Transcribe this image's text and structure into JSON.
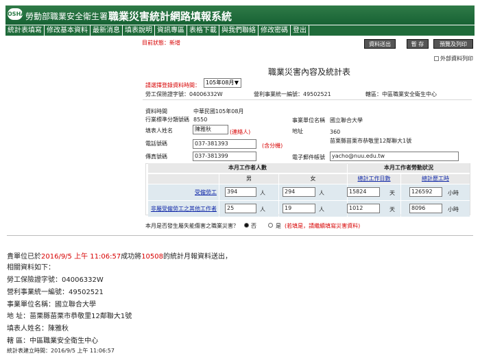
{
  "header": {
    "logo": "OSHA",
    "agency": "勞動部職業安全衛生署",
    "system": "職業災害統計網路填報系統"
  },
  "nav": [
    "統計表填寫",
    "修改基本資料",
    "最新消息",
    "填表說明",
    "資訊專區",
    "表格下載",
    "與我們聯絡",
    "修改密碼",
    "登出"
  ],
  "form": {
    "status": "目前狀態：新增",
    "buttons": {
      "send": "資料送出",
      "save": "暫 存",
      "preview": "預覽及列印"
    },
    "external": "外部資料列印",
    "title": "職業災害內容及統計表",
    "period_label": "請選擇登錄資料時間：",
    "period_value": "105年08月",
    "insurance": "勞工保險證字號：04006332W",
    "unified": "營利事業統一編號：49502521",
    "district": "轄區：中區職業安全衛生中心",
    "data_time_label": "資料時間",
    "data_time_value": "中華民國105年08月",
    "industry_label": "行業標準分類號碼",
    "industry_value": "8550",
    "unit_label": "事業單位名稱",
    "unit_value": "國立聯合大學",
    "filler_label": "填表人姓名",
    "filler_value": "陳雅秋",
    "contact_person": "(連絡人)",
    "address_label": "地址",
    "address_code": "360",
    "address_value": "苗栗縣苗栗市恭敬里12鄰聯大1號",
    "phone_label": "電話號碼",
    "phone_value": "037-381393",
    "phone_note": "(含分機)",
    "fax_label": "傳真號碼",
    "fax_value": "037-381399",
    "email_label": "電子郵件帳號",
    "email_value": "yacho@nuu.edu.tw"
  },
  "table": {
    "left_header": "本月工作者人數",
    "right_header": "本月工作者勞動狀況",
    "male": "男",
    "female": "女",
    "work_days": "總計工作日數",
    "work_hours": "總計歷工時",
    "rows": [
      {
        "label": "受僱勞工",
        "male": "394",
        "female": "294",
        "days": "15824",
        "hours": "126592"
      },
      {
        "label": "非屬受僱勞工之其他工作者",
        "male": "25",
        "female": "19",
        "days": "1012",
        "hours": "8096"
      }
    ],
    "unit_person": "人",
    "unit_day": "天",
    "unit_hour": "小時"
  },
  "question": {
    "text": "本月是否發生屬失能傷害之職業災害？",
    "no": "否",
    "yes": "是",
    "yes_note": "(若填是，請繼續填寫災害資料)"
  },
  "message": {
    "part1": "貴單位已於",
    "time": "2016/9/5 上午 11:06:57",
    "part2": "成功將",
    "count": "10508",
    "part3": "的統計月報資料送出，",
    "line2": "相關資料如下：",
    "lines": [
      "勞工保險證字號：04006332W",
      "營利事業統一編號：49502521",
      "事業單位名稱：國立聯合大學",
      "地 址：苗栗縣苗栗市恭敬里12鄰聯大1號",
      "填表人姓名：陳雅秋",
      "轄 區：中區職業安全衛生中心"
    ],
    "created": "統計表建立時間：2016/9/5 上午 11:06:57"
  }
}
